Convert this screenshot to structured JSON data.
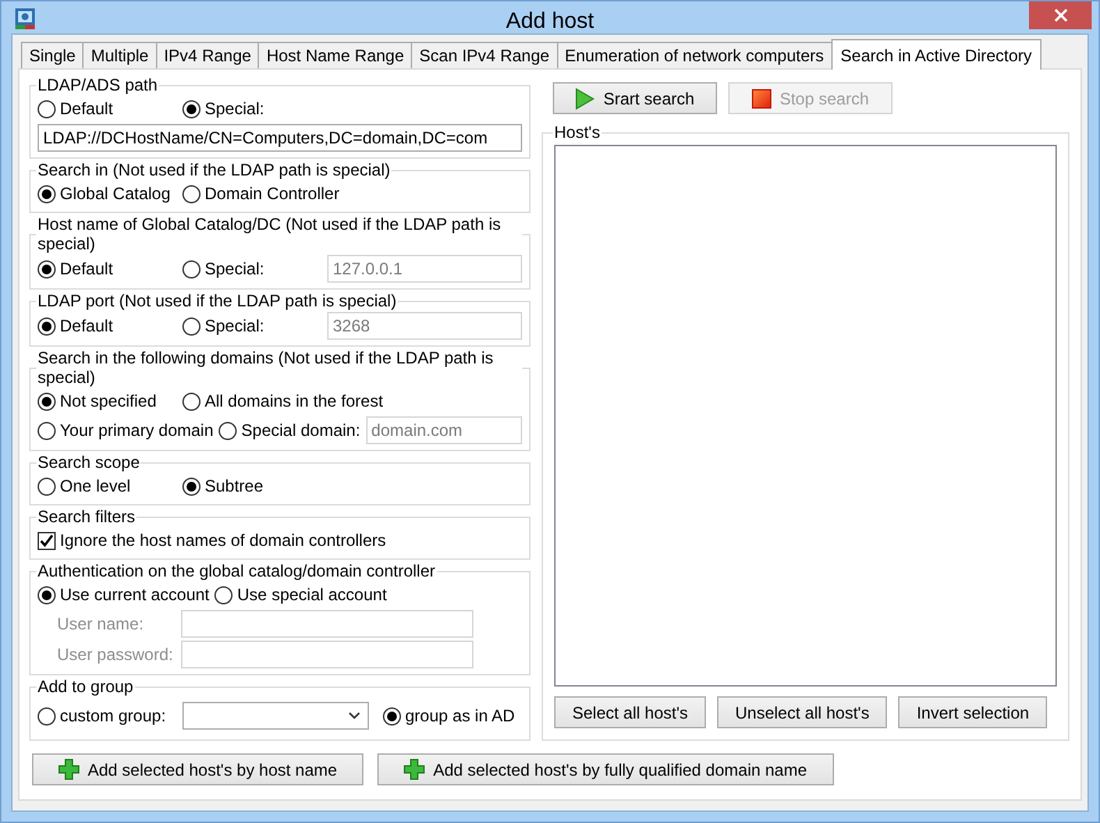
{
  "window": {
    "title": "Add host"
  },
  "tabs": [
    {
      "label": "Single",
      "selected": false
    },
    {
      "label": "Multiple",
      "selected": false
    },
    {
      "label": "IPv4 Range",
      "selected": false
    },
    {
      "label": "Host Name Range",
      "selected": false
    },
    {
      "label": "Scan IPv4 Range",
      "selected": false
    },
    {
      "label": "Enumeration of network computers",
      "selected": false
    },
    {
      "label": "Search in Active Directory",
      "selected": true
    }
  ],
  "groups": [
    {
      "title": "LDAP/ADS path",
      "rows": [
        [
          {
            "kind": "radio",
            "label": "Default",
            "selected": false
          },
          {
            "kind": "radio",
            "label": "Special:",
            "selected": true
          }
        ],
        [
          {
            "kind": "field",
            "value": "LDAP://DCHostName/CN=Computers,DC=domain,DC=com",
            "disabled": false
          }
        ]
      ]
    },
    {
      "title": "Search in (Not used if the LDAP path is special)",
      "rows": [
        [
          {
            "kind": "radio",
            "label": "Global Catalog",
            "selected": true
          },
          {
            "kind": "radio",
            "label": "Domain Controller",
            "selected": false
          }
        ]
      ]
    },
    {
      "title": "Host name of Global Catalog/DC (Not used if the LDAP path is special)",
      "rows": [
        [
          {
            "kind": "radio",
            "label": "Default",
            "selected": true
          },
          {
            "kind": "radio",
            "label": "Special:",
            "selected": false
          },
          {
            "kind": "field",
            "value": "127.0.0.1",
            "disabled": true
          }
        ]
      ]
    },
    {
      "title": "LDAP port (Not used if the LDAP path is special)",
      "rows": [
        [
          {
            "kind": "radio",
            "label": "Default",
            "selected": true
          },
          {
            "kind": "radio",
            "label": "Special:",
            "selected": false
          },
          {
            "kind": "field",
            "value": "3268",
            "disabled": true
          }
        ]
      ]
    },
    {
      "title": "Search in the following domains (Not used if the LDAP path is special)",
      "rows": [
        [
          {
            "kind": "radio",
            "label": "Not specified",
            "selected": true
          },
          {
            "kind": "radio",
            "label": "All domains in the forest",
            "selected": false
          }
        ],
        [
          {
            "kind": "radio",
            "label": "Your primary domain",
            "selected": false
          },
          {
            "kind": "radio",
            "label": "Special domain:",
            "selected": false
          },
          {
            "kind": "field",
            "value": "domain.com",
            "disabled": true
          }
        ]
      ]
    },
    {
      "title": "Search scope",
      "rows": [
        [
          {
            "kind": "radio",
            "label": "One level",
            "selected": false
          },
          {
            "kind": "radio",
            "label": "Subtree",
            "selected": true
          }
        ]
      ]
    },
    {
      "title": "Search filters",
      "rows": [
        [
          {
            "kind": "checkbox",
            "label": "Ignore the host names of domain controllers",
            "checked": true
          }
        ]
      ]
    },
    {
      "title": "Authentication on the global catalog/domain controller",
      "rows": [
        [
          {
            "kind": "radio",
            "label": "Use current account",
            "selected": true
          },
          {
            "kind": "radio",
            "label": "Use special account",
            "selected": false
          }
        ],
        [
          {
            "kind": "label",
            "label": "User name:",
            "disabled": true
          },
          {
            "kind": "field",
            "disabled": true
          }
        ],
        [
          {
            "kind": "label",
            "label": "User password:",
            "disabled": true
          },
          {
            "kind": "field",
            "disabled": true
          }
        ]
      ]
    },
    {
      "title": "Add to group",
      "rows": [
        [
          {
            "kind": "radio",
            "label": "custom group:",
            "selected": false
          },
          {
            "kind": "select"
          },
          {
            "kind": "radio",
            "label": "group as in AD",
            "selected": true
          }
        ]
      ]
    }
  ],
  "search_buttons": [
    {
      "kind": "start",
      "label": "Srart search",
      "disabled": false
    },
    {
      "kind": "stop",
      "label": "Stop search",
      "disabled": true
    }
  ],
  "hosts": {
    "title": "Host's",
    "buttons": [
      "Select all host's",
      "Unselect all host's",
      "Invert selection"
    ]
  },
  "add_buttons": [
    {
      "kind": "add",
      "label": "Add selected host's by host name"
    },
    {
      "kind": "add",
      "label": "Add selected host's by fully qualified domain name"
    }
  ]
}
